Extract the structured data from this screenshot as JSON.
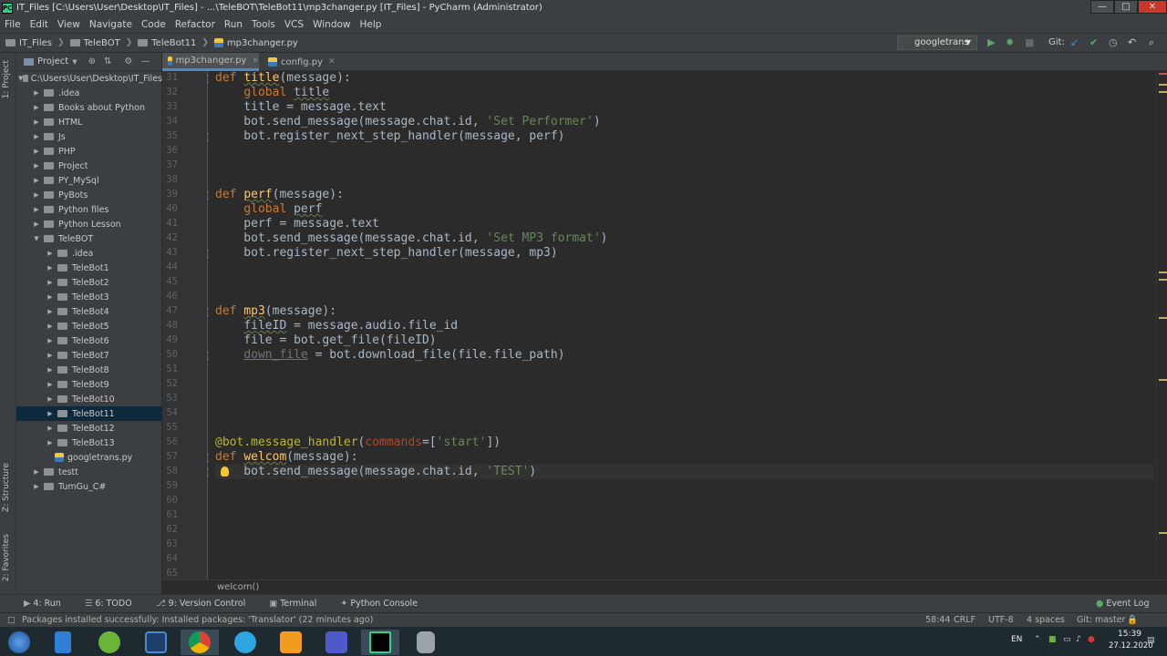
{
  "window": {
    "title": "IT_Files [C:\\Users\\User\\Desktop\\IT_Files] - ...\\TeleBOT\\TeleBot11\\mp3changer.py [IT_Files] - PyCharm (Administrator)",
    "app_icon": "PC",
    "controls": [
      "—",
      "□",
      "✕"
    ]
  },
  "menu": [
    "File",
    "Edit",
    "View",
    "Navigate",
    "Code",
    "Refactor",
    "Run",
    "Tools",
    "VCS",
    "Window",
    "Help"
  ],
  "navbar": {
    "breadcrumb": [
      "IT_Files",
      "TeleBOT",
      "TeleBot11",
      "mp3changer.py"
    ],
    "run_config": "googletrans",
    "git_label": "Git:"
  },
  "project_panel": {
    "title": "Project",
    "root": "C:\\Users\\User\\Desktop\\IT_Files",
    "items": [
      {
        "label": ".idea",
        "depth": 1,
        "type": "folder",
        "expanded": false
      },
      {
        "label": "Books about Python",
        "depth": 1,
        "type": "folder",
        "expanded": false
      },
      {
        "label": "HTML",
        "depth": 1,
        "type": "folder",
        "expanded": false
      },
      {
        "label": "Js",
        "depth": 1,
        "type": "folder",
        "expanded": false
      },
      {
        "label": "PHP",
        "depth": 1,
        "type": "folder",
        "expanded": false
      },
      {
        "label": "Project",
        "depth": 1,
        "type": "folder",
        "expanded": false
      },
      {
        "label": "PY_MySql",
        "depth": 1,
        "type": "folder",
        "expanded": false
      },
      {
        "label": "PyBots",
        "depth": 1,
        "type": "folder",
        "expanded": false
      },
      {
        "label": "Python files",
        "depth": 1,
        "type": "folder",
        "expanded": false
      },
      {
        "label": "Python Lesson",
        "depth": 1,
        "type": "folder",
        "expanded": false
      },
      {
        "label": "TeleBOT",
        "depth": 1,
        "type": "folder",
        "expanded": true
      },
      {
        "label": ".idea",
        "depth": 2,
        "type": "folder",
        "expanded": false
      },
      {
        "label": "TeleBot1",
        "depth": 2,
        "type": "folder",
        "expanded": false
      },
      {
        "label": "TeleBot2",
        "depth": 2,
        "type": "folder",
        "expanded": false
      },
      {
        "label": "TeleBot3",
        "depth": 2,
        "type": "folder",
        "expanded": false
      },
      {
        "label": "TeleBot4",
        "depth": 2,
        "type": "folder",
        "expanded": false
      },
      {
        "label": "TeleBot5",
        "depth": 2,
        "type": "folder",
        "expanded": false
      },
      {
        "label": "TeleBot6",
        "depth": 2,
        "type": "folder",
        "expanded": false
      },
      {
        "label": "TeleBot7",
        "depth": 2,
        "type": "folder",
        "expanded": false
      },
      {
        "label": "TeleBot8",
        "depth": 2,
        "type": "folder",
        "expanded": false
      },
      {
        "label": "TeleBot9",
        "depth": 2,
        "type": "folder",
        "expanded": false
      },
      {
        "label": "TeleBot10",
        "depth": 2,
        "type": "folder",
        "expanded": false
      },
      {
        "label": "TeleBot11",
        "depth": 2,
        "type": "folder",
        "expanded": false,
        "selected": true
      },
      {
        "label": "TeleBot12",
        "depth": 2,
        "type": "folder",
        "expanded": false
      },
      {
        "label": "TeleBot13",
        "depth": 2,
        "type": "folder",
        "expanded": false
      },
      {
        "label": "googletrans.py",
        "depth": 2,
        "type": "file"
      },
      {
        "label": "testt",
        "depth": 1,
        "type": "folder",
        "expanded": false
      },
      {
        "label": "TumGu_C#",
        "depth": 1,
        "type": "folder",
        "expanded": false
      }
    ]
  },
  "left_strip": [
    "1: Project",
    "Z: Structure",
    "2: Favorites"
  ],
  "tabs": [
    {
      "label": "mp3changer.py",
      "active": true
    },
    {
      "label": "config.py",
      "active": false
    }
  ],
  "editor": {
    "line_numbers": [
      "31",
      "32",
      "33",
      "34",
      "35",
      "36",
      "37",
      "38",
      "39",
      "40",
      "41",
      "42",
      "43",
      "44",
      "45",
      "46",
      "47",
      "48",
      "49",
      "50",
      "51",
      "52",
      "53",
      "54",
      "55",
      "56",
      "57",
      "58",
      "59",
      "60",
      "61",
      "62",
      "63",
      "64",
      "65"
    ],
    "lines": [
      "def title(message):",
      "    global title",
      "    title = message.text",
      "    bot.send_message(message.chat.id, 'Set Performer')",
      "    bot.register_next_step_handler(message, perf)",
      "",
      "",
      "",
      "def perf(message):",
      "    global perf",
      "    perf = message.text",
      "    bot.send_message(message.chat.id, 'Set MP3 format')",
      "    bot.register_next_step_handler(message, mp3)",
      "",
      "",
      "",
      "def mp3(message):",
      "    fileID = message.audio.file_id",
      "    file = bot.get_file(fileID)",
      "    down_file = bot.download_file(file.file_path)",
      "",
      "",
      "",
      "",
      "",
      "@bot.message_handler(commands=['start'])",
      "def welcom(message):",
      "    bot.send_message(message.chat.id, 'TEST')",
      "",
      "",
      "",
      "",
      "",
      "",
      ""
    ],
    "breadcrumb": "welcom()"
  },
  "bottom_tools": [
    "4: Run",
    "6: TODO",
    "9: Version Control",
    "Terminal",
    "Python Console"
  ],
  "event_log": "Event Log",
  "status": {
    "message": "Packages installed successfully: Installed packages: 'Translator' (22 minutes ago)",
    "position": "58:44",
    "line_sep": "CRLF",
    "encoding": "UTF-8",
    "indent": "4 spaces",
    "git": "Git: master"
  },
  "taskbar": {
    "lang": "EN",
    "time": "15:39",
    "date": "27.12.2020"
  },
  "colors": {
    "keyword": "#cc7832",
    "function": "#ffc66d",
    "string": "#6a8759",
    "decorator": "#bbb529",
    "param": "#aa4926",
    "text": "#a9b7c6"
  }
}
